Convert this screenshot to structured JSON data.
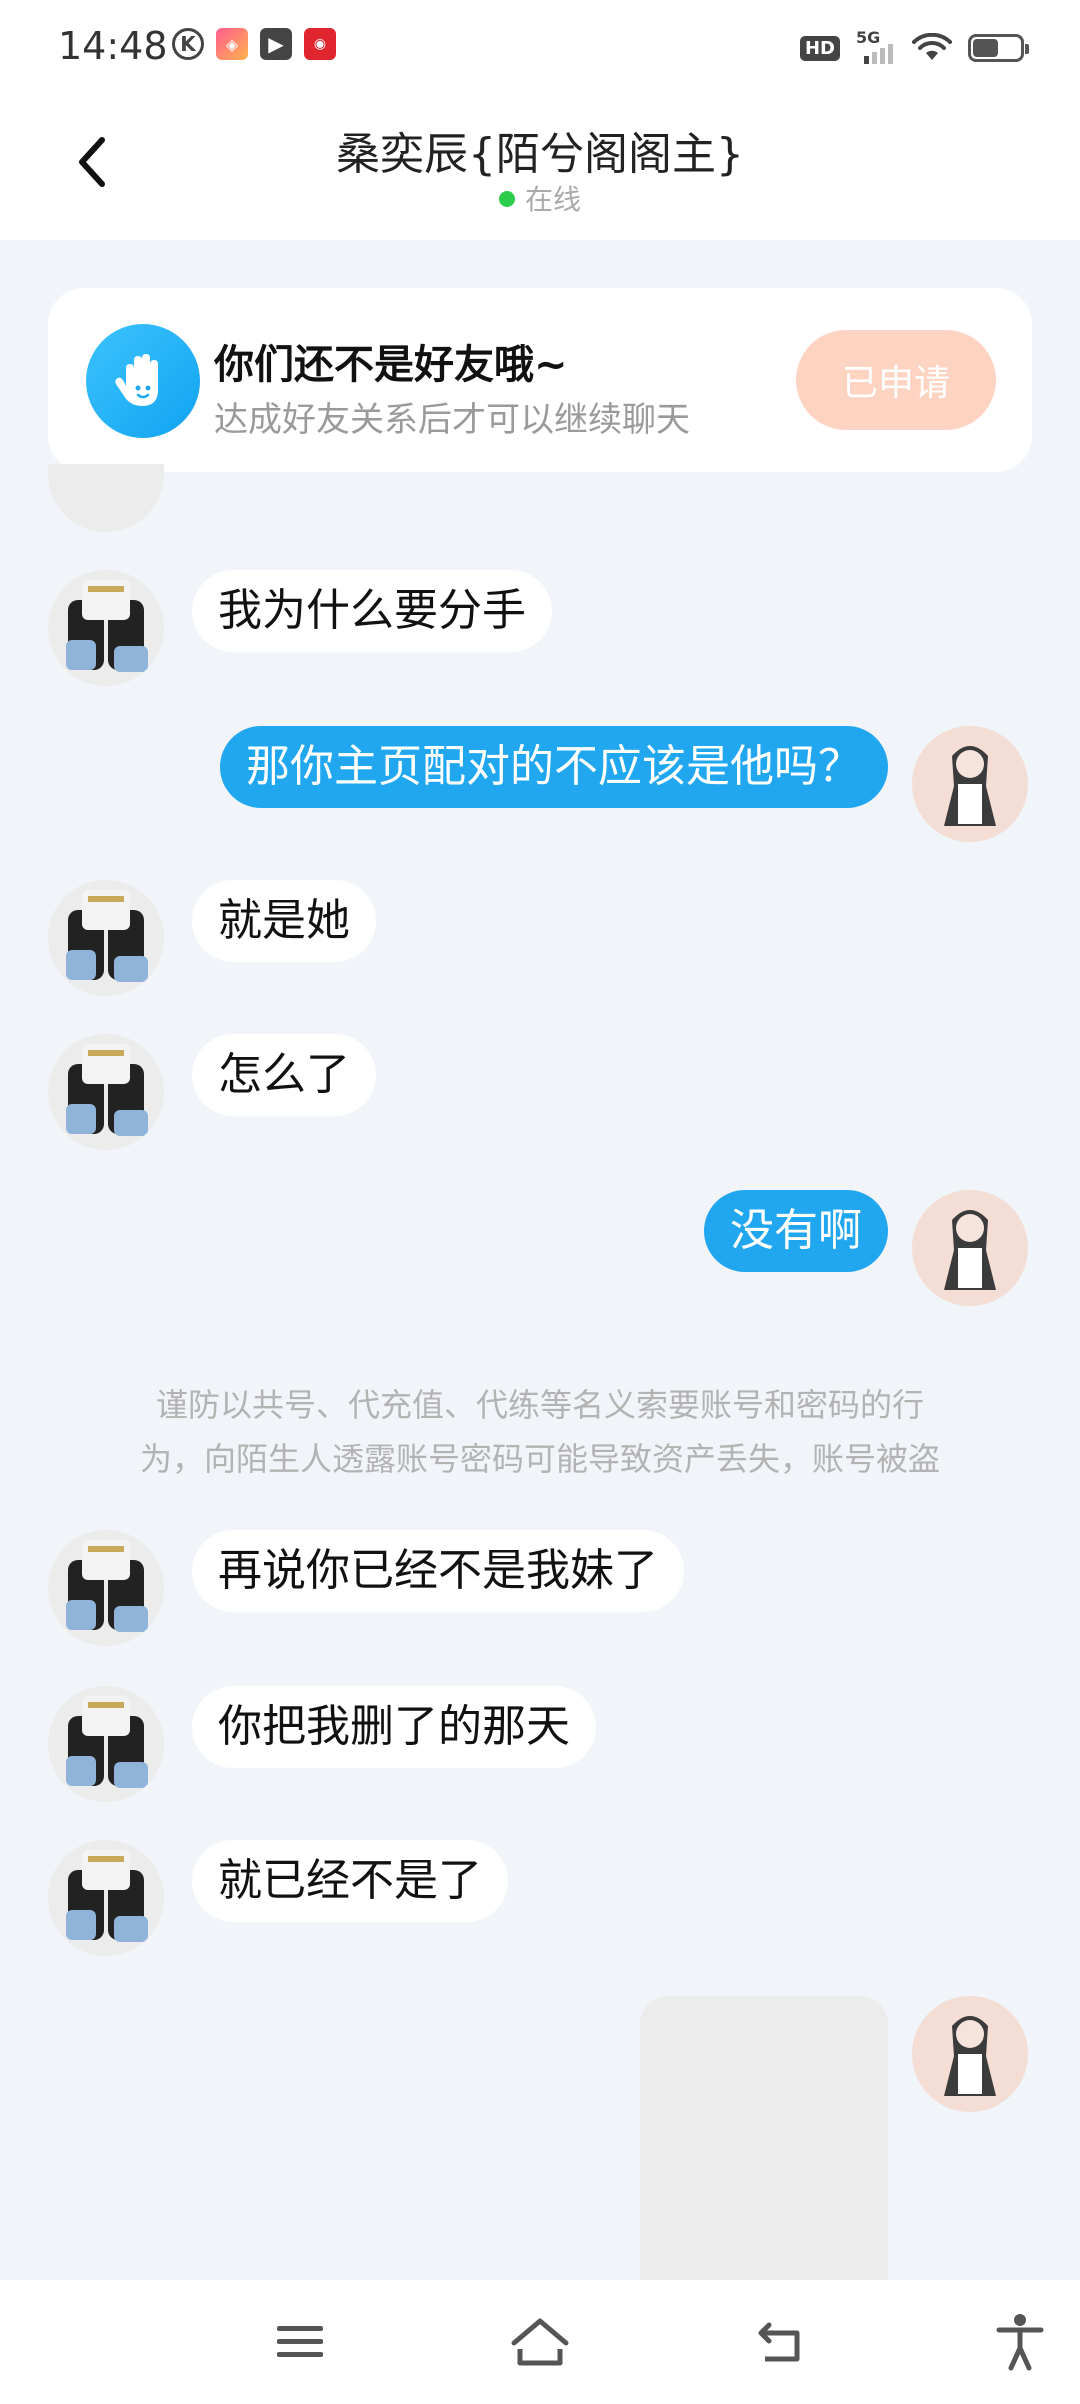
{
  "status_bar": {
    "time": "14:48",
    "network": "5G",
    "hd_label": "HD",
    "battery_level": 0.55,
    "app_icons": [
      "k-icon",
      "app-icon",
      "video-icon",
      "news-icon"
    ]
  },
  "header": {
    "title": "桑奕辰{陌兮阁阁主}",
    "status": "在线",
    "status_color": "#2ccc4c"
  },
  "friend_card": {
    "title": "你们还不是好友哦~",
    "subtitle": "达成好友关系后才可以继续聊天",
    "button_label": "已申请"
  },
  "messages": [
    {
      "from": "them",
      "text": "我为什么要分手"
    },
    {
      "from": "me",
      "text": "那你主页配对的不应该是他吗？"
    },
    {
      "from": "them",
      "text": "就是她"
    },
    {
      "from": "them",
      "text": "怎么了"
    },
    {
      "from": "me",
      "text": "没有啊"
    },
    {
      "from": "them",
      "text": "再说你已经不是我妹了"
    },
    {
      "from": "them",
      "text": "你把我删了的那天"
    },
    {
      "from": "them",
      "text": "就已经不是了"
    }
  ],
  "warning_lines": [
    "谨防以共号、代充值、代练等名义索要账号和密码的行",
    "为，向陌生人透露账号密码可能导致资产丢失，账号被盗"
  ],
  "colors": {
    "accent": "#21a7f0",
    "background": "#f1f4f8",
    "applied_button": "#fdd3c2"
  },
  "nav_icons": [
    "menu-icon",
    "home-icon",
    "back-icon",
    "accessibility-icon"
  ]
}
